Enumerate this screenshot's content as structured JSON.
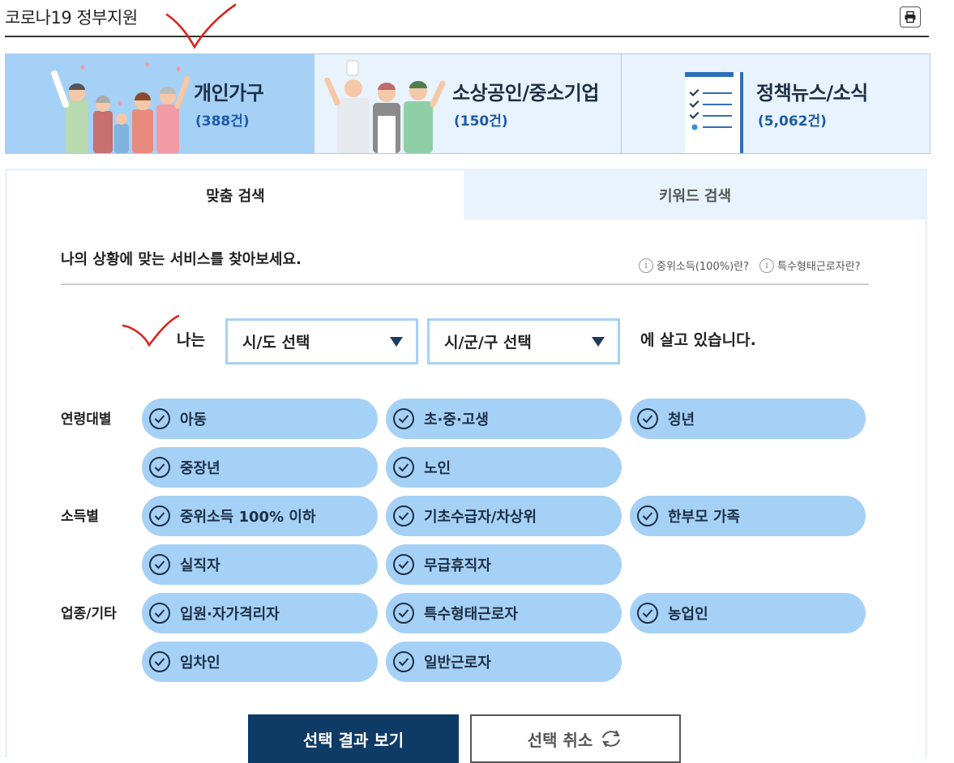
{
  "header": {
    "title": "코로나19 정부지원",
    "print_icon": "printer-icon"
  },
  "categories": [
    {
      "title": "개인가구",
      "count": "(388건)",
      "active": true
    },
    {
      "title": "소상공인/중소기업",
      "count": "(150건)",
      "active": false
    },
    {
      "title": "정책뉴스/소식",
      "count": "(5,062건)",
      "active": false
    }
  ],
  "tabs": [
    {
      "label": "맞춤 검색",
      "active": true
    },
    {
      "label": "키워드 검색",
      "active": false
    }
  ],
  "search": {
    "intro": "나의 상황에 맞는 서비스를 찾아보세요.",
    "help_links": [
      "중위소득(100%)란?",
      "특수형태근로자란?"
    ],
    "location_prefix": "나는",
    "province_select": "시/도 선택",
    "district_select": "시/군/구 선택",
    "location_suffix": "에 살고 있습니다."
  },
  "groups": [
    {
      "label": "연령대별"
    },
    {
      "label": "소득별"
    },
    {
      "label": "업종/기타"
    }
  ],
  "chips": [
    "아동",
    "초·중·고생",
    "청년",
    "중장년",
    "노인",
    "중위소득 100% 이하",
    "기초수급자/차상위",
    "한부모 가족",
    "실직자",
    "무급휴직자",
    "입원·자가격리자",
    "특수형태근로자",
    "농업인",
    "임차인",
    "일반근로자"
  ],
  "buttons": {
    "submit": "선택 결과 보기",
    "reset": "선택 취소"
  },
  "colors": {
    "chip": "#a6d1f6",
    "active_card": "#a6d1f6",
    "card": "#e8f3fd",
    "primary": "#0e3a66",
    "count": "#1d5aa8",
    "annotation": "#d9231f"
  }
}
